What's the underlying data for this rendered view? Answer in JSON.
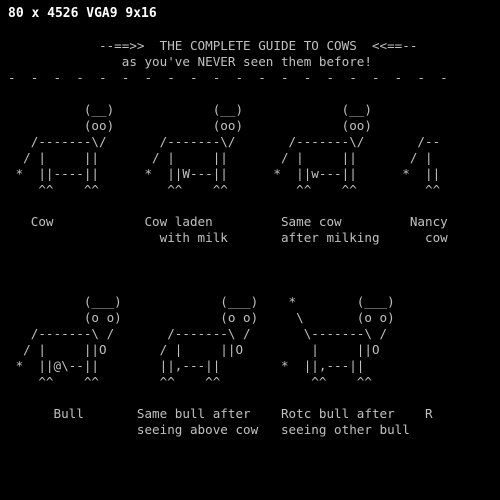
{
  "status_bar": {
    "mode_text": "80 x 4526 VGA9 9x16"
  },
  "terminal": {
    "lines": [
      "            --==>>  THE COMPLETE GUIDE TO COWS  <<==--",
      "               as you've NEVER seen them before!",
      "-  -  -  -  -  -  -  -  -  -  -  -  -  -  -  -  -  -  -  -",
      "",
      "          (__)             (__)             (__)",
      "          (oo)             (oo)             (oo)",
      "   /-------\\/       /-------\\/       /-------\\/       /--",
      "  / |     ||       / |     ||       / |     ||       / |",
      " *  ||----||      *  ||W---||      *  ||w---||      *  ||",
      "    ^^    ^^         ^^    ^^         ^^    ^^         ^^",
      "",
      "   Cow            Cow laden         Same cow         Nancy",
      "                    with milk       after milking      cow",
      "",
      "",
      "",
      "          (___)             (___)    *        (___)",
      "          (o o)             (o o)     \\       (o o)",
      "   /-------\\ /       /-------\\ /       \\-------\\ /",
      "  / |     ||O       / |     ||O         |     ||O",
      " *  ||@\\--||        ||,---||        *  ||,---||",
      "    ^^    ^^        ^^    ^^            ^^    ^^",
      "",
      "      Bull       Same bull after    Rotc bull after    R",
      "                 seeing above cow   seeing other bull"
    ]
  }
}
